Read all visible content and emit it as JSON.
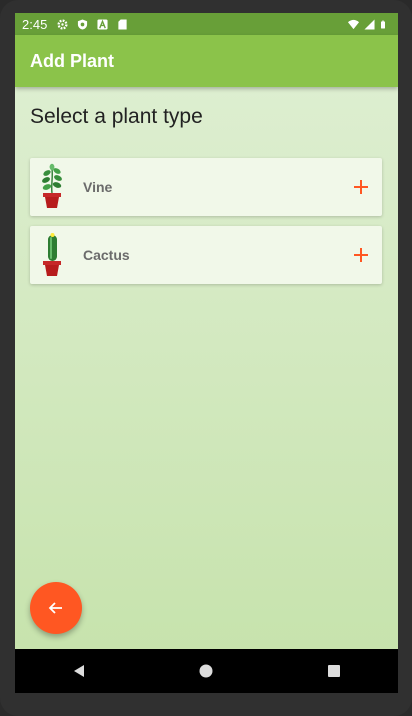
{
  "status_bar": {
    "time": "2:45",
    "left_icons": [
      "settings-icon",
      "shield-icon",
      "a-icon",
      "sd-card-icon"
    ],
    "right_icons": [
      "wifi-icon",
      "signal-icon",
      "battery-icon"
    ]
  },
  "app_bar": {
    "title": "Add Plant"
  },
  "main": {
    "heading": "Select a plant type",
    "plants": [
      {
        "label": "Vine",
        "icon": "vine-plant-icon"
      },
      {
        "label": "Cactus",
        "icon": "cactus-plant-icon"
      }
    ]
  },
  "fab": {
    "icon": "arrow-left-icon"
  },
  "nav_bar": {
    "buttons": [
      "back-icon",
      "home-icon",
      "recents-icon"
    ]
  },
  "colors": {
    "status_bar": "#689f38",
    "app_bar": "#8bc34a",
    "card": "#f1f8e9",
    "accent": "#ff5722"
  }
}
